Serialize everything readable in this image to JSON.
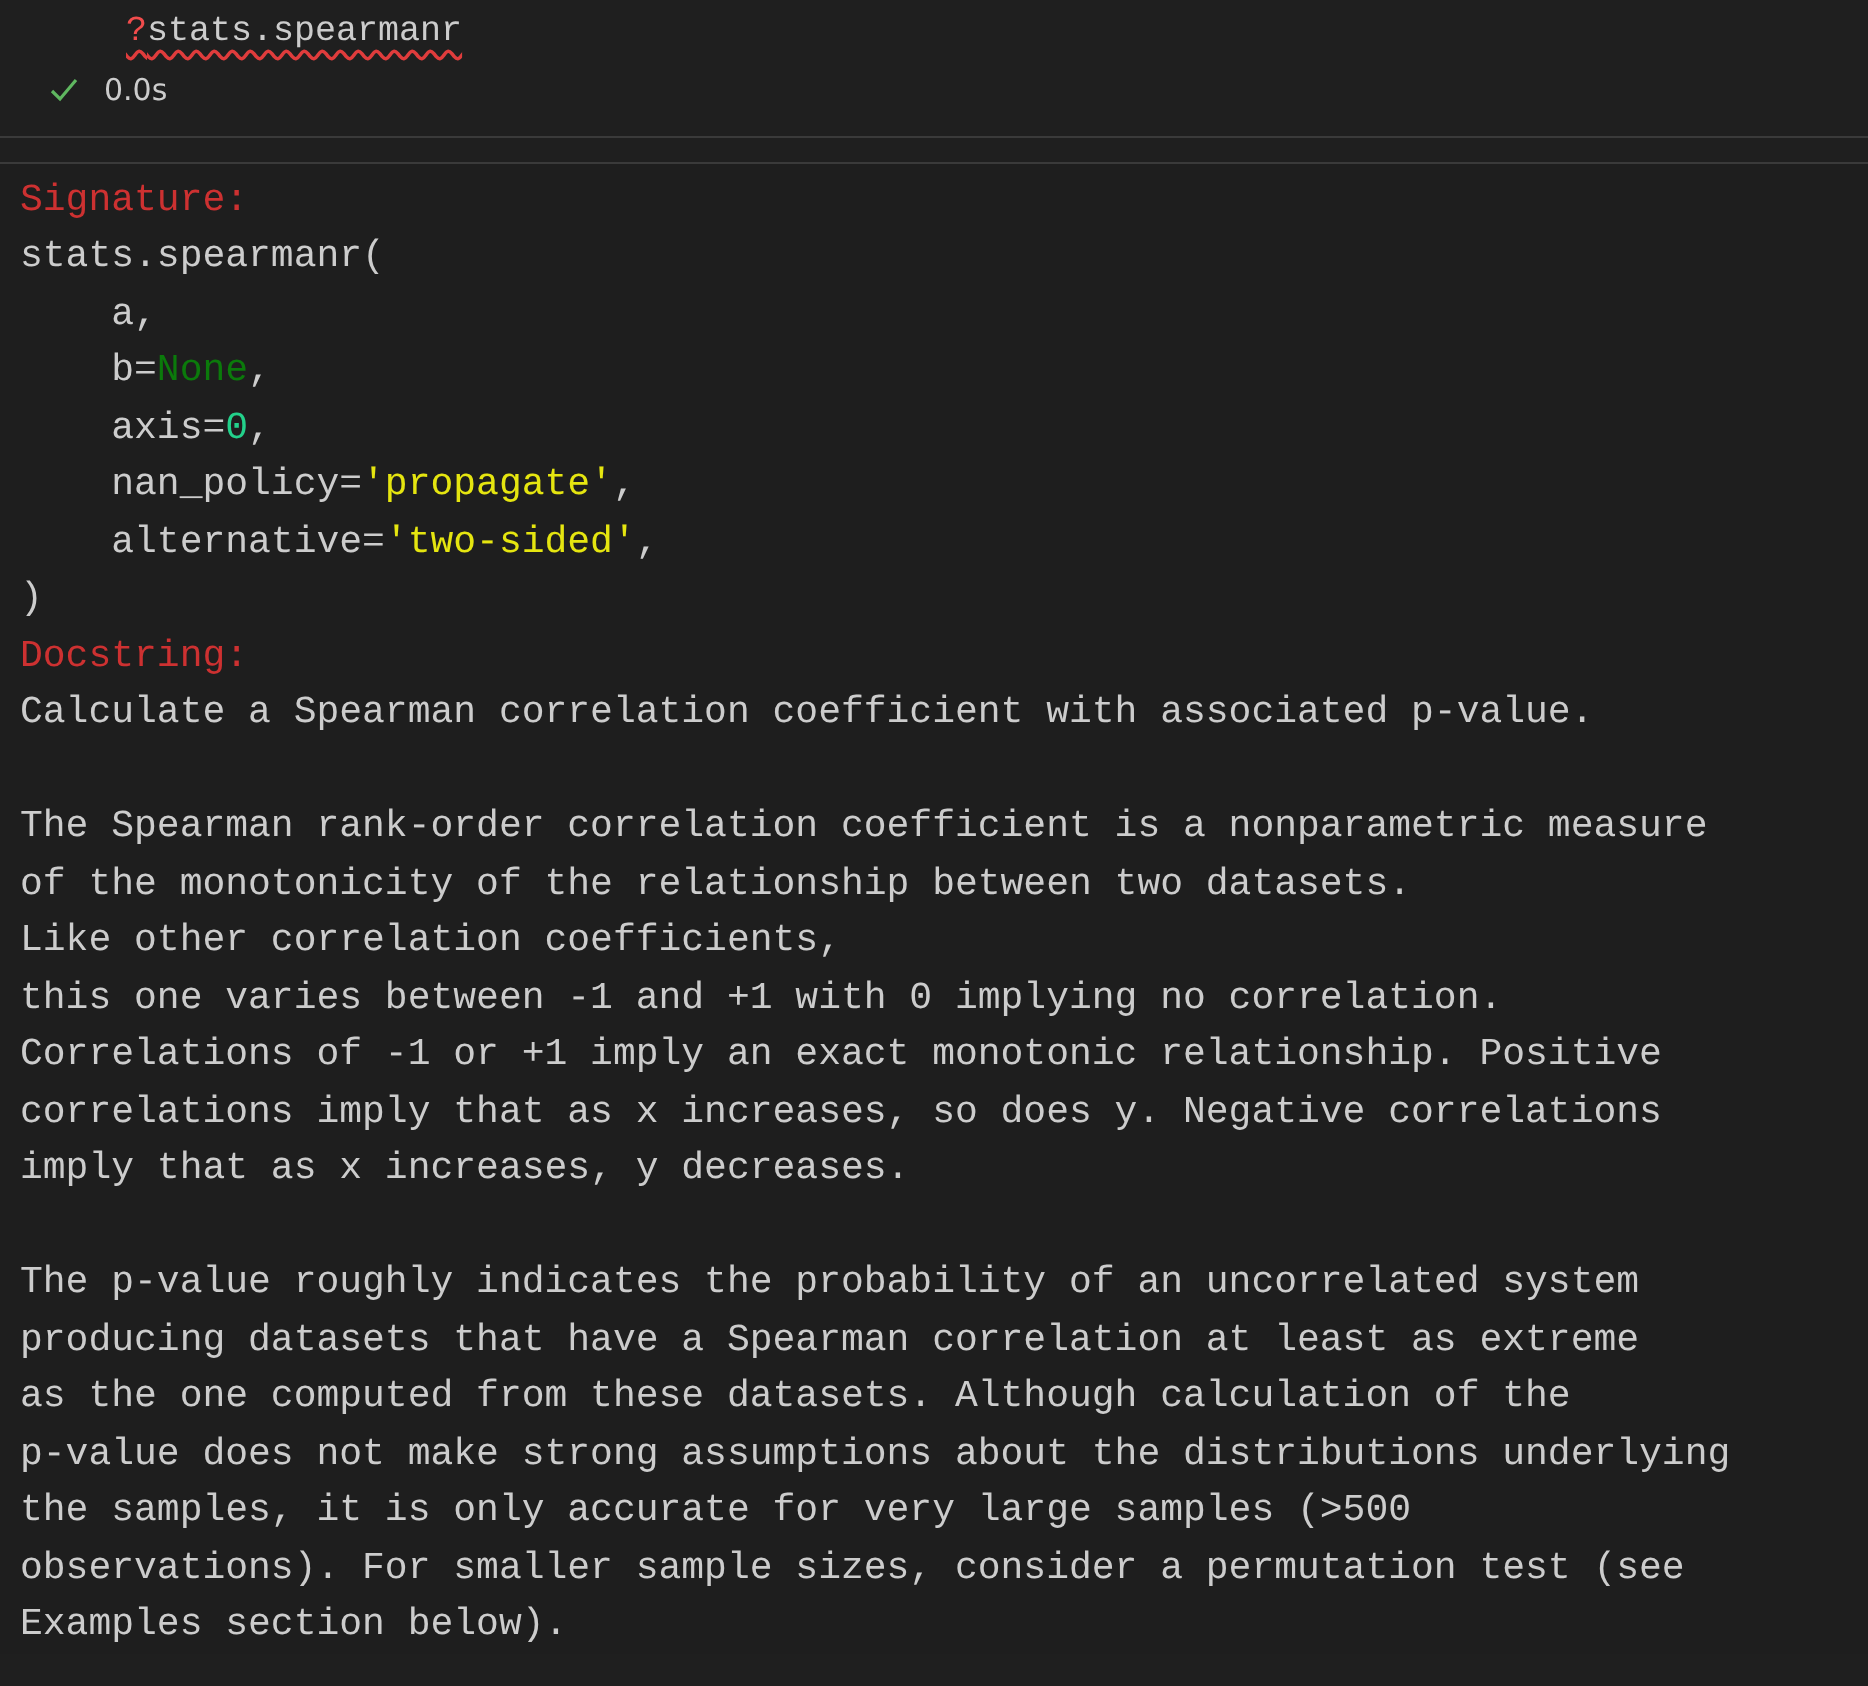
{
  "cell": {
    "code": [
      {
        "text": "?",
        "kind": "error"
      },
      {
        "text": "stats.spearmanr",
        "kind": "plain"
      }
    ],
    "error_underline": true,
    "status": {
      "success": true,
      "duration": "0.0s"
    }
  },
  "output": {
    "signature_label": "Signature:",
    "signature": [
      [
        {
          "text": "stats.spearmanr(",
          "kind": "plain"
        }
      ],
      [
        {
          "text": "    a,",
          "kind": "plain"
        }
      ],
      [
        {
          "text": "    b=",
          "kind": "plain"
        },
        {
          "text": "None",
          "kind": "constant"
        },
        {
          "text": ",",
          "kind": "plain"
        }
      ],
      [
        {
          "text": "    axis=",
          "kind": "plain"
        },
        {
          "text": "0",
          "kind": "number"
        },
        {
          "text": ",",
          "kind": "plain"
        }
      ],
      [
        {
          "text": "    nan_policy=",
          "kind": "plain"
        },
        {
          "text": "'propagate'",
          "kind": "string"
        },
        {
          "text": ",",
          "kind": "plain"
        }
      ],
      [
        {
          "text": "    alternative=",
          "kind": "plain"
        },
        {
          "text": "'two-sided'",
          "kind": "string"
        },
        {
          "text": ",",
          "kind": "plain"
        }
      ],
      [
        {
          "text": ")",
          "kind": "plain"
        }
      ]
    ],
    "docstring_label": "Docstring:",
    "docstring": [
      [
        "Calculate a Spearman correlation coefficient with associated p-value."
      ],
      [
        "The Spearman rank-order correlation coefficient is a nonparametric measure",
        "of the monotonicity of the relationship between two datasets.",
        "Like other correlation coefficients,",
        "this one varies between -1 and +1 with 0 implying no correlation.",
        "Correlations of -1 or +1 imply an exact monotonic relationship. Positive",
        "correlations imply that as x increases, so does y. Negative correlations",
        "imply that as x increases, y decreases."
      ],
      [
        "The p-value roughly indicates the probability of an uncorrelated system",
        "producing datasets that have a Spearman correlation at least as extreme",
        "as the one computed from these datasets. Although calculation of the",
        "p-value does not make strong assumptions about the distributions underlying",
        "the samples, it is only accurate for very large samples (>500",
        "observations). For smaller sample sizes, consider a permutation test (see",
        "Examples section below)."
      ]
    ]
  }
}
